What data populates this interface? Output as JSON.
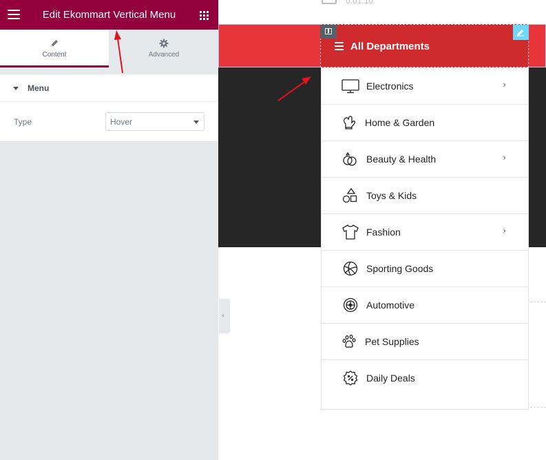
{
  "panel": {
    "title": "Edit Ekommart Vertical Menu",
    "header_color": "#93003c",
    "tabs": [
      {
        "label": "Content",
        "icon": "pencil-icon",
        "active": true
      },
      {
        "label": "Advanced",
        "icon": "gear-icon",
        "active": false
      }
    ],
    "section": {
      "label": "Menu"
    },
    "controls": {
      "type": {
        "label": "Type",
        "value": "Hover"
      }
    }
  },
  "preview": {
    "top_stub_text": "0.01.10",
    "departments": {
      "title": "All Departments",
      "bar_color": "#e8353c",
      "header_color": "#cf2b2f",
      "items": [
        {
          "label": "Electronics",
          "icon": "monitor-icon",
          "has_submenu": true
        },
        {
          "label": "Home & Garden",
          "icon": "glove-icon",
          "has_submenu": false
        },
        {
          "label": "Beauty & Health",
          "icon": "rings-icon",
          "has_submenu": true
        },
        {
          "label": "Toys & Kids",
          "icon": "shapes-icon",
          "has_submenu": false
        },
        {
          "label": "Fashion",
          "icon": "tshirt-icon",
          "has_submenu": true
        },
        {
          "label": "Sporting Goods",
          "icon": "volleyball-icon",
          "has_submenu": false
        },
        {
          "label": "Automotive",
          "icon": "wheel-icon",
          "has_submenu": false
        },
        {
          "label": "Pet Supplies",
          "icon": "paw-icon",
          "has_submenu": false
        },
        {
          "label": "Daily Deals",
          "icon": "discount-badge-icon",
          "has_submenu": false
        }
      ]
    }
  }
}
